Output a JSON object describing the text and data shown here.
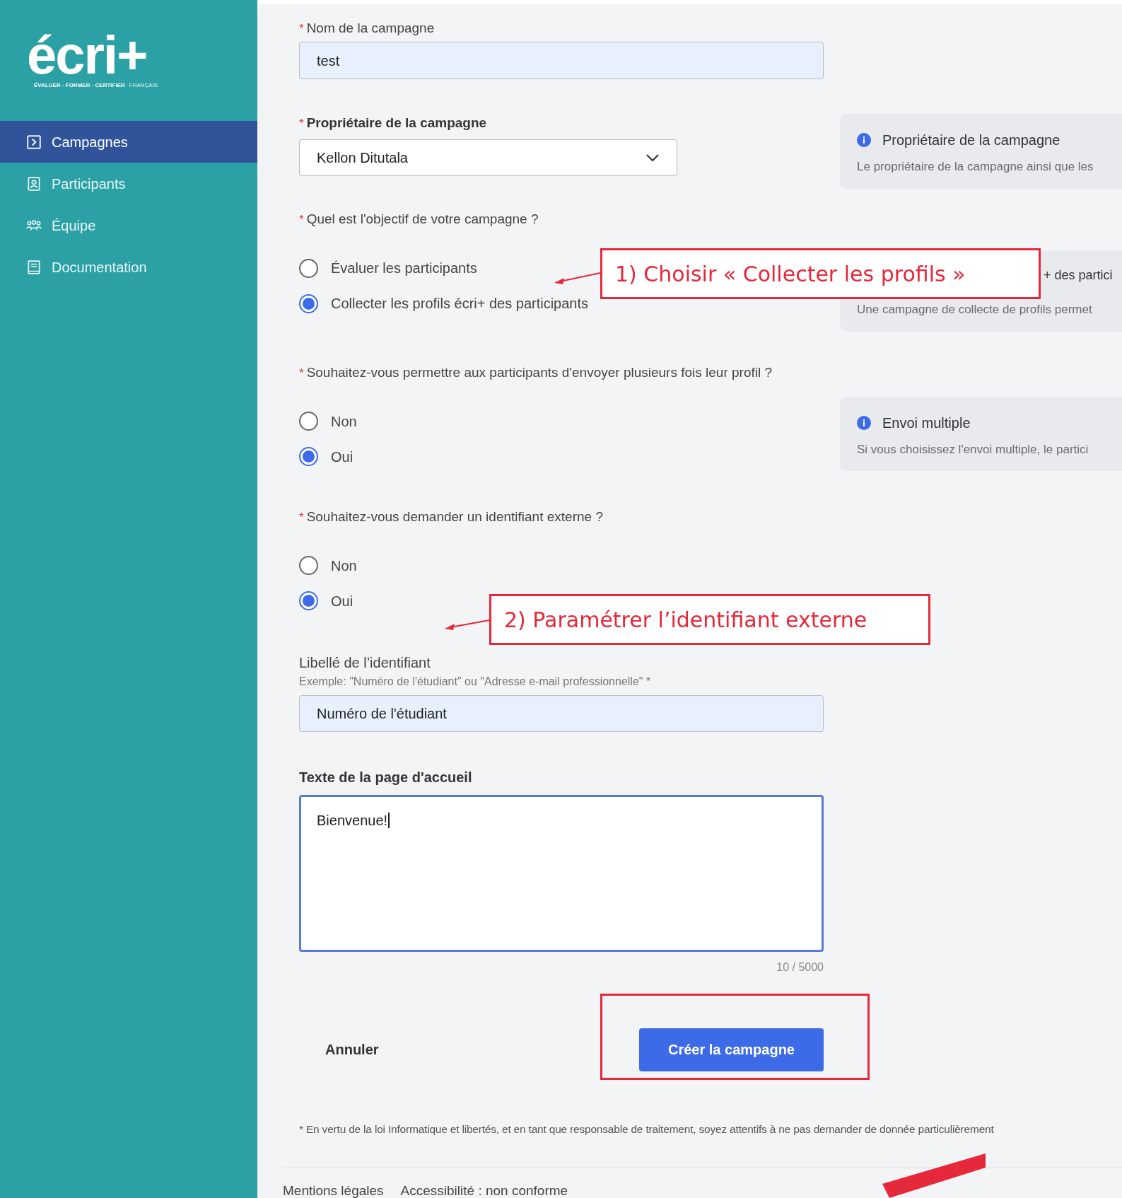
{
  "sidebar": {
    "logo": {
      "wordmark": "écri+",
      "tagline": "ÉVALUER - FORMER - CERTIFIER",
      "language": "FRANÇAIS"
    },
    "items": [
      {
        "label": "Campagnes",
        "selected": true
      },
      {
        "label": "Participants",
        "selected": false
      },
      {
        "label": "Équipe",
        "selected": false
      },
      {
        "label": "Documentation",
        "selected": false
      }
    ]
  },
  "form": {
    "campaign_name": {
      "mark": "*",
      "label": "Nom de la campagne",
      "value": "test"
    },
    "owner": {
      "mark": "*",
      "label": "Propriétaire de la campagne",
      "value": "Kellon Ditutala"
    },
    "questions": [
      {
        "mark": "*",
        "label": "Quel est l'objectif de votre campagne ?",
        "options": [
          {
            "label": "Évaluer les participants",
            "selected": false
          },
          {
            "label": "Collecter les profils écri+ des participants",
            "selected": true
          }
        ]
      },
      {
        "mark": "*",
        "label": "Souhaitez-vous permettre aux participants d'envoyer plusieurs fois leur profil ?",
        "options": [
          {
            "label": "Non",
            "selected": false
          },
          {
            "label": "Oui",
            "selected": true
          }
        ]
      },
      {
        "mark": "*",
        "label": "Souhaitez-vous demander un identifiant externe ?",
        "options": [
          {
            "label": "Non",
            "selected": false
          },
          {
            "label": "Oui",
            "selected": true
          }
        ]
      }
    ],
    "identifier": {
      "label": "Libellé de l’identifiant",
      "hint": "Exemple: \"Numéro de l'étudiant\" ou \"Adresse e-mail professionnelle\" *",
      "value": "Numéro de l'étudiant"
    },
    "welcome": {
      "label": "Texte de la page d'accueil",
      "value": "Bienvenue!",
      "counter": "10 / 5000"
    },
    "cancel": "Annuler",
    "submit": "Créer la campagne",
    "footnote": "* En vertu de la loi Informatique et libertés, et en tant que responsable de traitement, soyez attentifs à ne pas demander de donnée particulièrement"
  },
  "info_cards": [
    {
      "title": "Propriétaire de la campagne",
      "text": "Le propriétaire de la campagne ainsi que les"
    },
    {
      "title": "+ des partici",
      "text": "Une campagne de collecte de profils permet"
    },
    {
      "title": "Envoi multiple",
      "text": "Si vous choisissez l'envoi multiple, le partici"
    }
  ],
  "footer_links": [
    "Mentions légales",
    "Accessibilité : non conforme"
  ],
  "annotations": [
    {
      "kind": "callout",
      "text": "1) Choisir « Collecter les profils »"
    },
    {
      "kind": "callout",
      "text": "2) Paramétrer l’identifiant externe"
    },
    {
      "kind": "highlight"
    },
    {
      "kind": "stroke"
    }
  ]
}
